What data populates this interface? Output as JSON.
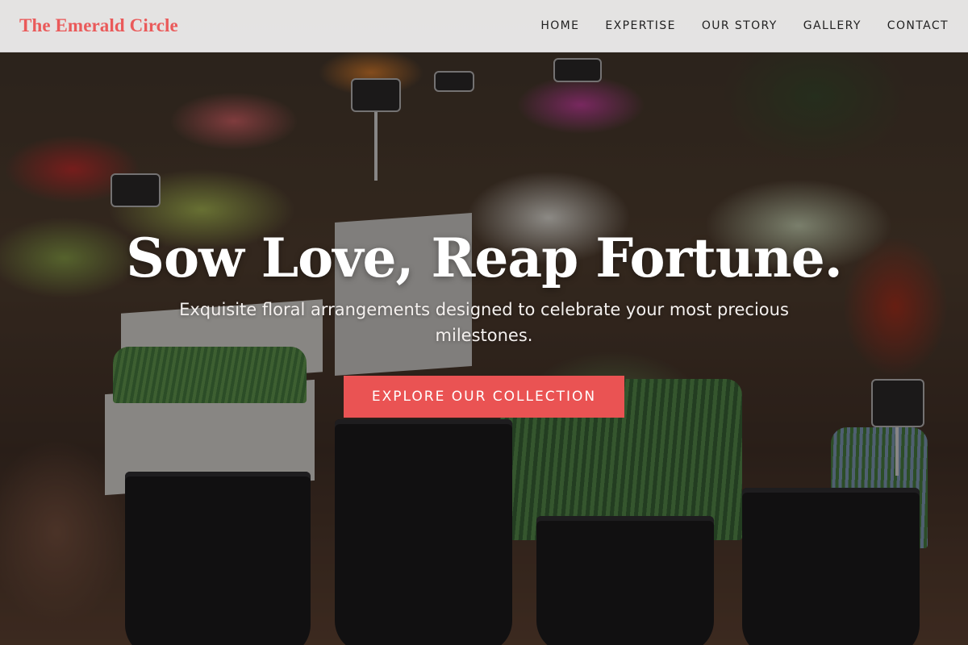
{
  "brand": {
    "name": "The Emerald Circle"
  },
  "nav": {
    "items": [
      "HOME",
      "EXPERTISE",
      "OUR STORY",
      "GALLERY",
      "CONTACT"
    ]
  },
  "hero": {
    "headline": "Sow Love, Reap Fortune.",
    "subtitle": "Exquisite floral arrangements designed to celebrate your most precious milestones.",
    "cta_label": "EXPLORE OUR COLLECTION"
  },
  "colors": {
    "accent": "#ea5353",
    "brand": "#ea5a5a",
    "header_bg": "#f2f2f2",
    "text_light": "#ffffff"
  }
}
